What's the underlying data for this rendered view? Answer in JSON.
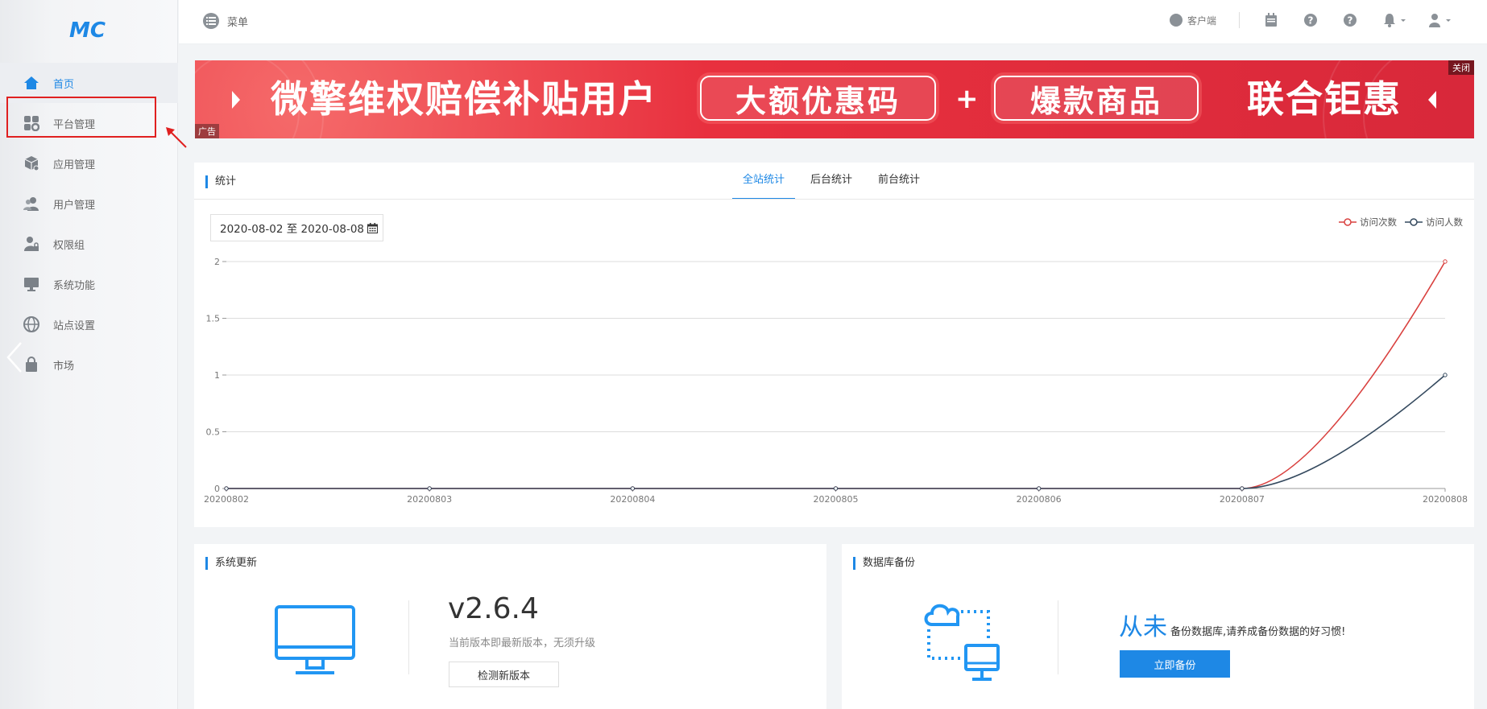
{
  "sidebar": {
    "logo_text": "MC",
    "items": [
      {
        "label": "首页",
        "icon": "home-icon"
      },
      {
        "label": "平台管理",
        "icon": "grid-gear-icon"
      },
      {
        "label": "应用管理",
        "icon": "package-icon"
      },
      {
        "label": "用户管理",
        "icon": "users-icon"
      },
      {
        "label": "权限组",
        "icon": "user-lock-icon"
      },
      {
        "label": "系统功能",
        "icon": "monitor-icon"
      },
      {
        "label": "站点设置",
        "icon": "globe-icon"
      },
      {
        "label": "市场",
        "icon": "shopping-bag-icon"
      }
    ]
  },
  "topbar": {
    "menu_label": "菜单",
    "client_label": "客户端"
  },
  "banner": {
    "headline": "微擎维权赔偿补贴用户",
    "pill1": "大额优惠码",
    "plus": "+",
    "pill2": "爆款商品",
    "tagline": "联合钜惠",
    "close_label": "关闭",
    "ad_label": "广告"
  },
  "stats": {
    "title": "统计",
    "tabs": [
      "全站统计",
      "后台统计",
      "前台统计"
    ],
    "date_range": "2020-08-02 至 2020-08-08"
  },
  "chart_data": {
    "type": "line",
    "categories": [
      "20200802",
      "20200803",
      "20200804",
      "20200805",
      "20200806",
      "20200807",
      "20200808"
    ],
    "series": [
      {
        "name": "访问次数",
        "values": [
          0,
          0,
          0,
          0,
          0,
          0,
          2
        ],
        "color": "#d9413f"
      },
      {
        "name": "访问人数",
        "values": [
          0,
          0,
          0,
          0,
          0,
          0,
          1
        ],
        "color": "#34495e"
      }
    ],
    "yticks": [
      "0",
      "0.5",
      "1",
      "1.5",
      "2"
    ],
    "ylim": [
      0,
      2
    ],
    "legend": "top-right",
    "grid": true
  },
  "update": {
    "title": "系统更新",
    "version": "v2.6.4",
    "note": "当前版本即最新版本，无须升级",
    "button": "检测新版本"
  },
  "backup": {
    "title": "数据库备份",
    "big_text": "从未",
    "small_text": "备份数据库,请养成备份数据的好习惯!",
    "button": "立即备份"
  }
}
